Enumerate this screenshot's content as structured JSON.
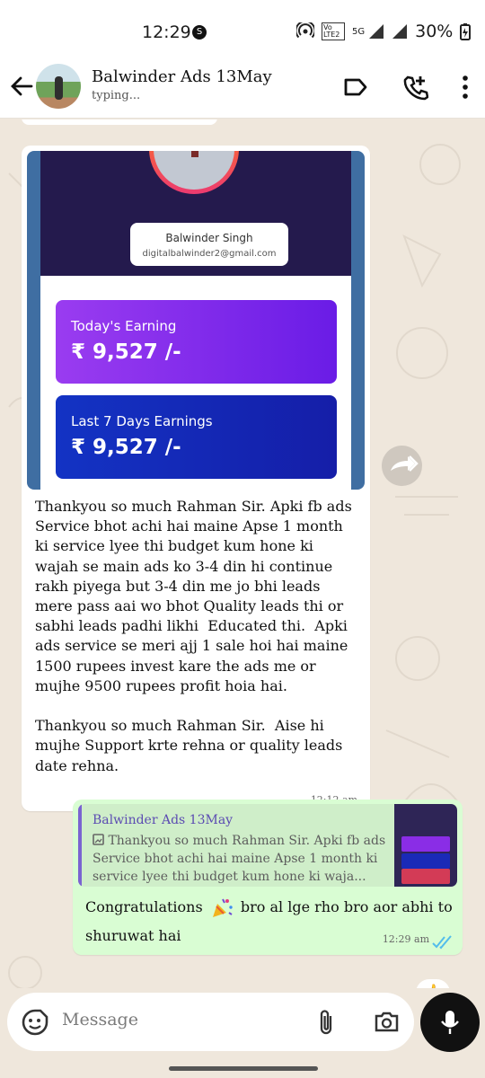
{
  "status": {
    "time": "12:29",
    "net_badge": "Vo LTE2",
    "net_type": "5G",
    "battery": "30%"
  },
  "header": {
    "name": "Balwinder Ads 13May",
    "subtitle": "typing..."
  },
  "incoming": {
    "profile_name": "Balwinder Singh",
    "profile_email": "digitalbalwinder2@gmail.com",
    "todays_label": "Today's Earning",
    "todays_amount": "₹ 9,527 /-",
    "last7_label": "Last 7 Days Earnings",
    "last7_amount": "₹ 9,527 /-",
    "text": "Thankyou so much Rahman Sir. Apki fb ads Service bhot achi hai maine Apse 1 month ki service lyee thi budget kum hone ki wajah se main ads ko 3-4 din hi continue rakh piyega but 3-4 din me jo bhi leads mere pass aai wo bhot Quality leads thi or sabhi leads padhi likhi  Educated thi.  Apki ads service se meri ajj 1 sale hoi hai maine 1500 rupees invest kare the ads me or mujhe 9500 rupees profit hoia hai.\n\nThankyou so much Rahman Sir.  Aise hi mujhe Support krte rehna or quality leads date rehna.",
    "time": "12:12 am"
  },
  "outgoing": {
    "reply_to_name": "Balwinder Ads 13May",
    "reply_to_text": "Thankyou so much Rahman Sir. Apki fb ads Service bhot achi hai maine Apse 1 month ki service lyee thi budget kum hone ki waja...",
    "text_before_emoji": "Congratulations",
    "text_after_emoji": "bro al lge rho bro aor abhi to shuruwat hai",
    "time": "12:29 am",
    "reaction": "👍"
  },
  "composer": {
    "placeholder": "Message"
  },
  "colors": {
    "accent": "#25d366",
    "read_tick": "#53bdeb",
    "chat_bg": "#efe7dc"
  }
}
